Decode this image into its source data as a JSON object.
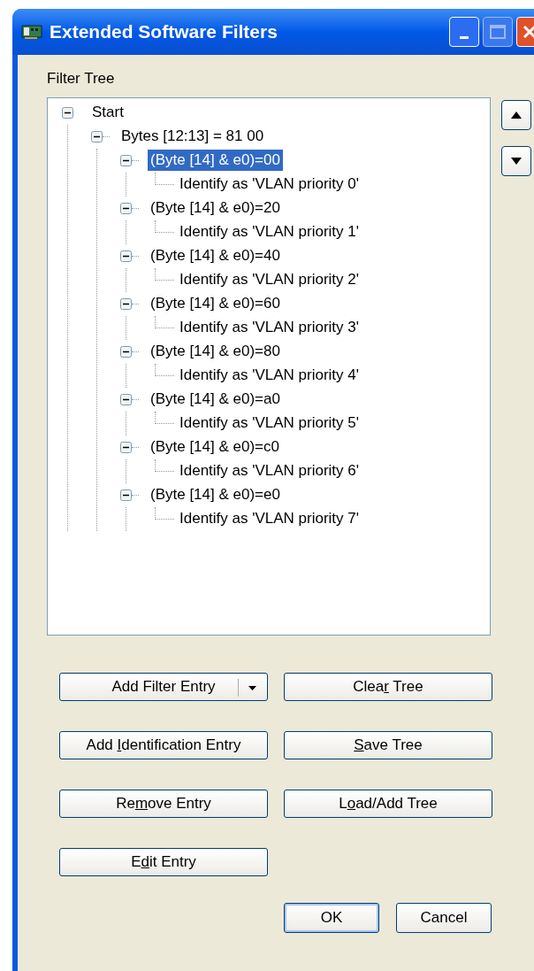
{
  "window": {
    "title": "Extended Software Filters"
  },
  "tree_label": "Filter Tree",
  "tree": [
    {
      "label": "Start",
      "expanded": true,
      "selected": false,
      "children": [
        {
          "label": "Bytes [12:13] = 81 00",
          "expanded": true,
          "selected": false,
          "children": [
            {
              "label": "(Byte [14] & e0)=00",
              "expanded": true,
              "selected": true,
              "children": [
                {
                  "label": "Identify as 'VLAN priority 0'",
                  "selected": false
                }
              ]
            },
            {
              "label": "(Byte [14] & e0)=20",
              "expanded": true,
              "selected": false,
              "children": [
                {
                  "label": "Identify as 'VLAN priority 1'",
                  "selected": false
                }
              ]
            },
            {
              "label": "(Byte [14] & e0)=40",
              "expanded": true,
              "selected": false,
              "children": [
                {
                  "label": "Identify as 'VLAN priority 2'",
                  "selected": false
                }
              ]
            },
            {
              "label": "(Byte [14] & e0)=60",
              "expanded": true,
              "selected": false,
              "children": [
                {
                  "label": "Identify as 'VLAN priority 3'",
                  "selected": false
                }
              ]
            },
            {
              "label": "(Byte [14] & e0)=80",
              "expanded": true,
              "selected": false,
              "children": [
                {
                  "label": "Identify as 'VLAN priority 4'",
                  "selected": false
                }
              ]
            },
            {
              "label": "(Byte [14] & e0)=a0",
              "expanded": true,
              "selected": false,
              "children": [
                {
                  "label": "Identify as 'VLAN priority 5'",
                  "selected": false
                }
              ]
            },
            {
              "label": "(Byte [14] & e0)=c0",
              "expanded": true,
              "selected": false,
              "children": [
                {
                  "label": "Identify as 'VLAN priority 6'",
                  "selected": false
                }
              ]
            },
            {
              "label": "(Byte [14] & e0)=e0",
              "expanded": true,
              "selected": false,
              "children": [
                {
                  "label": "Identify as 'VLAN priority 7'",
                  "selected": false
                }
              ]
            }
          ]
        }
      ]
    }
  ],
  "buttons": [
    {
      "kind": "split",
      "before": "Add Filter Entry"
    },
    {
      "kind": "plain",
      "before": "Clea",
      "key": "r",
      "after": " Tree"
    },
    {
      "kind": "plain",
      "before": "Add ",
      "key": "I",
      "after": "dentification Entry"
    },
    {
      "kind": "plain",
      "key": "S",
      "after": "ave Tree"
    },
    {
      "kind": "plain",
      "before": "Re",
      "key": "m",
      "after": "ove Entry"
    },
    {
      "kind": "plain",
      "before": "L",
      "key": "o",
      "after": "ad/Add Tree"
    },
    {
      "kind": "plain",
      "before": "E",
      "key": "d",
      "after": "it Entry"
    }
  ],
  "dialog_buttons": [
    {
      "label": "OK",
      "default": true
    },
    {
      "label": "Cancel",
      "default": false
    }
  ]
}
